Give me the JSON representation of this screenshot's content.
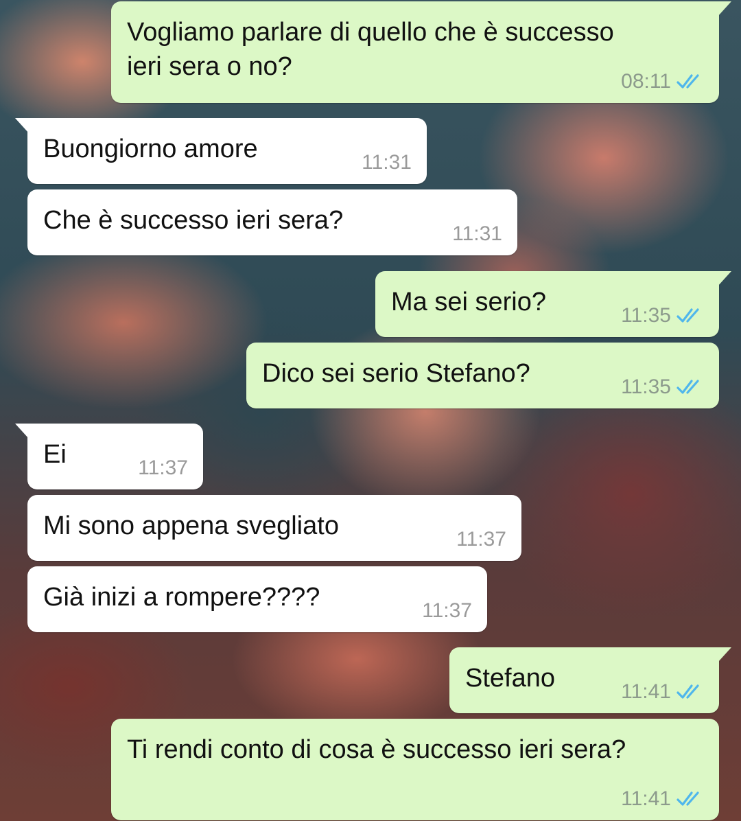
{
  "colors": {
    "outgoing_bubble": "#dcf8c6",
    "incoming_bubble": "#ffffff",
    "read_ticks": "#4fb6ec"
  },
  "messages": [
    {
      "direction": "out",
      "text": "Vogliamo parlare di quello che è successo\nieri sera o no?",
      "time": "08:11",
      "status": "read-ticks-icon"
    },
    {
      "direction": "in",
      "text": "Buongiorno amore",
      "time": "11:31"
    },
    {
      "direction": "in",
      "text": "Che è successo ieri sera?",
      "time": "11:31"
    },
    {
      "direction": "out",
      "text": "Ma sei serio?",
      "time": "11:35",
      "status": "read-ticks-icon"
    },
    {
      "direction": "out",
      "text": "Dico sei serio Stefano?",
      "time": "11:35",
      "status": "read-ticks-icon"
    },
    {
      "direction": "in",
      "text": "Ei",
      "time": "11:37"
    },
    {
      "direction": "in",
      "text": "Mi sono appena svegliato",
      "time": "11:37"
    },
    {
      "direction": "in",
      "text": "Già inizi a rompere????",
      "time": "11:37"
    },
    {
      "direction": "out",
      "text": "Stefano",
      "time": "11:41",
      "status": "read-ticks-icon"
    },
    {
      "direction": "out",
      "text": "Ti rendi conto di cosa è successo ieri sera?",
      "time": "11:41",
      "status": "read-ticks-icon"
    }
  ]
}
